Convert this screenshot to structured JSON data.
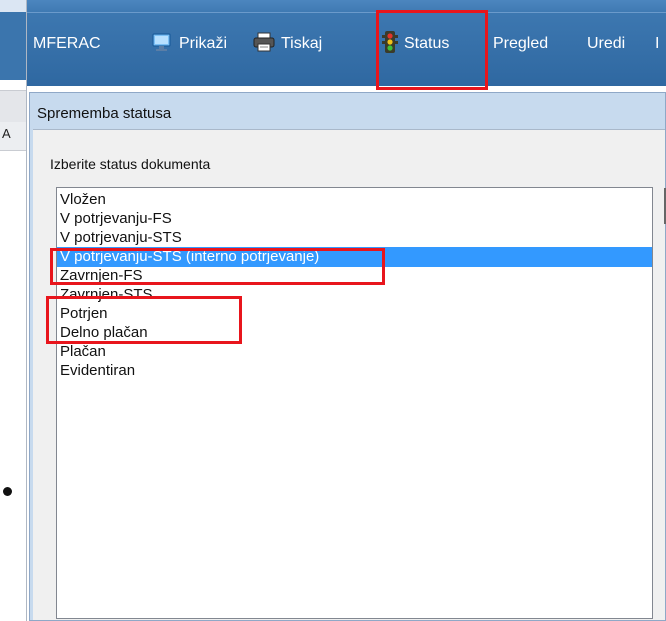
{
  "toolbar": {
    "items": [
      {
        "label": "MFERAC",
        "icon": "app-icon"
      },
      {
        "label": "Prikaži",
        "icon": "monitor-icon"
      },
      {
        "label": "Tiskaj",
        "icon": "printer-icon"
      },
      {
        "label": "Status",
        "icon": "traffic-light-icon"
      },
      {
        "label": "Pregled"
      },
      {
        "label": "Uredi"
      },
      {
        "label": "I"
      }
    ]
  },
  "dialog": {
    "title": "Sprememba statusa",
    "group_label": "Izberite status dokumenta",
    "statuses": [
      {
        "label": "Vložen",
        "selected": false
      },
      {
        "label": "V potrjevanju-FS",
        "selected": false
      },
      {
        "label": "V potrjevanju-STS",
        "selected": false
      },
      {
        "label": "V potrjevanju-STS (interno potrjevanje)",
        "selected": true
      },
      {
        "label": "Zavrnjen-FS",
        "selected": false
      },
      {
        "label": "Zavrnjen-STS",
        "selected": false
      },
      {
        "label": "Potrjen",
        "selected": false
      },
      {
        "label": "Delno plačan",
        "selected": false
      },
      {
        "label": "Plačan",
        "selected": false
      },
      {
        "label": "Evidentiran",
        "selected": false
      }
    ]
  },
  "background": {
    "fragment_text": "A"
  },
  "colors": {
    "toolbar": "#3a74ad",
    "selection": "#3399ff",
    "annotation": "#e8151c",
    "dialog_frame": "#c7daee"
  }
}
